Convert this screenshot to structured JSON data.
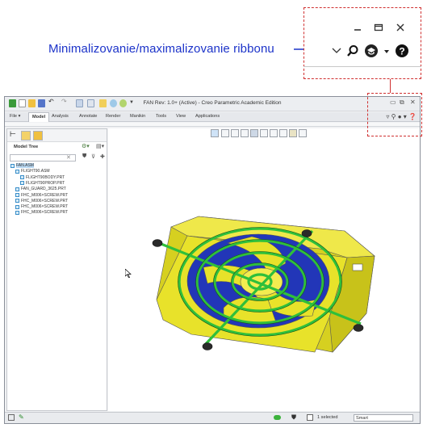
{
  "annotation": {
    "label": "Minimalizovanie/maximalizovanie ribbonu"
  },
  "app": {
    "title": "FAN Rev: 1.0+ (Active) - Creo Parametric Academic Edition",
    "tabs": [
      {
        "label": "File",
        "active": false
      },
      {
        "label": "Model",
        "active": true
      },
      {
        "label": "Analysis",
        "active": false
      },
      {
        "label": "Annotate",
        "active": false
      },
      {
        "label": "Render",
        "active": false
      },
      {
        "label": "Manikin",
        "active": false
      },
      {
        "label": "Tools",
        "active": false
      },
      {
        "label": "View",
        "active": false
      },
      {
        "label": "Applications",
        "active": false
      }
    ],
    "window_controls": {
      "minimize": "▭",
      "restore": "⧉",
      "close": "✕"
    }
  },
  "model_tree": {
    "title": "Model Tree",
    "items": [
      {
        "label": "FAN.ASM",
        "level": 0,
        "selected": true
      },
      {
        "label": "FLIGHT90.ASM",
        "level": 1,
        "selected": false
      },
      {
        "label": "FLIGHT90BODY.PRT",
        "level": 2,
        "selected": false
      },
      {
        "label": "FLIGHT90PROP.PRT",
        "level": 2,
        "selected": false
      },
      {
        "label": "FAN_GUARD_3625.PRT",
        "level": 1,
        "selected": false
      },
      {
        "label": "FHC_M006×SCREW.PRT",
        "level": 1,
        "selected": false
      },
      {
        "label": "FHC_M006×SCREW.PRT",
        "level": 1,
        "selected": false
      },
      {
        "label": "FHC_M006×SCREW.PRT",
        "level": 1,
        "selected": false
      },
      {
        "label": "FHC_M006×SCREW.PRT",
        "level": 1,
        "selected": false
      }
    ]
  },
  "status_bar": {
    "selected_text": "1 selected",
    "filter_value": "Smart"
  },
  "colors": {
    "annotation_blue": "#1c33c9",
    "callout_red": "#d03030",
    "fan_body": "#e8e22a",
    "fan_guard": "#2fbf3b",
    "fan_blade": "#1d2fa6"
  }
}
